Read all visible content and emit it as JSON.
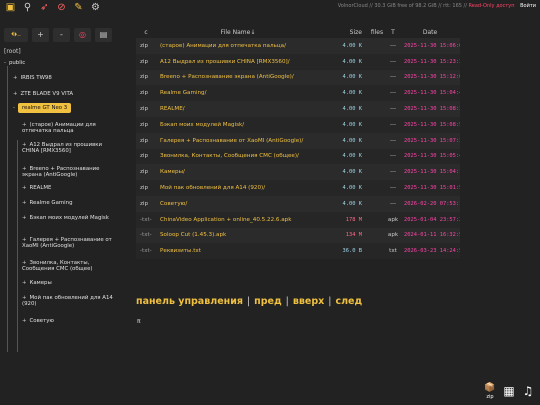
{
  "status": {
    "storage": "VolnorCloud // 30.3 GiB free of 98.2 GiB // rtt: 165 //",
    "readonly": "Read-Only доступ",
    "login": "Войти"
  },
  "toolbar_icons": [
    "package-icon",
    "search-icon",
    "rocket-icon",
    "unpost-icon",
    "broom-icon",
    "gear-icon"
  ],
  "left_tools": {
    "first": "⏴⏵..",
    "plus": "+",
    "minus": "-",
    "target": "◎",
    "doc": "▤"
  },
  "tree": {
    "root": "[root]",
    "public": "public",
    "items": [
      {
        "pfx": "+",
        "label": "IRBIS TW98"
      },
      {
        "pfx": "+",
        "label": "ZTE BLADE V9 VITA"
      },
      {
        "pfx": "-",
        "label": "realme GT Neo 3"
      }
    ],
    "children": [
      {
        "pfx": "+",
        "label": "(старое) Анимации для отпечатка пальца"
      },
      {
        "pfx": "+",
        "label": "A12 Выдрал из прошивки CHINA [RMX3560]"
      },
      {
        "pfx": "+",
        "label": "Breeno + Распознавание экрана (AntiGoogle)"
      },
      {
        "pfx": "+",
        "label": "REALME"
      },
      {
        "pfx": "+",
        "label": "Realme Gaming"
      },
      {
        "pfx": "+",
        "label": "Бэкап моих модулей Magisk"
      },
      {
        "pfx": "+",
        "label": "Галерея + Распознавание от XaoMI (AntiGoogle)"
      },
      {
        "pfx": "+",
        "label": "Звонилка, Контакты, Сообщения СМС (общее)"
      },
      {
        "pfx": "+",
        "label": "Камеры"
      },
      {
        "pfx": "+",
        "label": "Мой пак обновлений для A14 (920)"
      },
      {
        "pfx": "+",
        "label": "Советую"
      }
    ]
  },
  "table": {
    "headers": {
      "c": "c",
      "name": "File Name",
      "sort": "↓",
      "size": "Size",
      "files": "files",
      "type": "T",
      "date": "Date"
    },
    "rows": [
      {
        "c": "zip",
        "name": "(старое) Анимации для отпечатка пальца/",
        "size": "4.00 K",
        "files": "",
        "type": "---",
        "date": "2025-11-30 15:06:03"
      },
      {
        "c": "zip",
        "name": "A12 Выдрал из прошивки CHINA [RMX3560]/",
        "size": "4.00 K",
        "files": "",
        "type": "---",
        "date": "2025-11-30 15:23:34"
      },
      {
        "c": "zip",
        "name": "Breeno + Распознавание экрана (AntiGoogle)/",
        "size": "4.00 K",
        "files": "",
        "type": "---",
        "date": "2025-11-30 15:12:09"
      },
      {
        "c": "zip",
        "name": "Realme Gaming/",
        "size": "4.00 K",
        "files": "",
        "type": "---",
        "date": "2025-11-30 15:04:48"
      },
      {
        "c": "zip",
        "name": "REALME/",
        "size": "4.00 K",
        "files": "",
        "type": "---",
        "date": "2025-11-30 15:08:33"
      },
      {
        "c": "zip",
        "name": "Бэкап моих модулей Magisk/",
        "size": "4.00 K",
        "files": "",
        "type": "---",
        "date": "2025-11-30 15:08:57"
      },
      {
        "c": "zip",
        "name": "Галерея + Распознавание от XaoMI (AntiGoogle)/",
        "size": "4.00 K",
        "files": "",
        "type": "---",
        "date": "2025-11-30 15:07:36"
      },
      {
        "c": "zip",
        "name": "Звонилка, Контакты, Сообщения СМС (общее)/",
        "size": "4.00 K",
        "files": "",
        "type": "---",
        "date": "2025-11-30 15:05:43"
      },
      {
        "c": "zip",
        "name": "Камеры/",
        "size": "4.00 K",
        "files": "",
        "type": "---",
        "date": "2025-11-30 15:04:10"
      },
      {
        "c": "zip",
        "name": "Мой пак обновлений для A14 (920)/",
        "size": "4.00 K",
        "files": "",
        "type": "---",
        "date": "2025-11-30 15:01:54"
      },
      {
        "c": "zip",
        "name": "Советую/",
        "size": "4.00 K",
        "files": "",
        "type": "---",
        "date": "2026-02-20 07:53:16"
      },
      {
        "c": "-txt-",
        "name": "ChinaVideo Application + online_40.5.22.6.apk",
        "size": "178 M",
        "files": "",
        "type": "apk",
        "date": "2025-01-04 23:57:27"
      },
      {
        "c": "-txt-",
        "name": "Soloop Cut (1.45.3).apk",
        "size": "134 M",
        "files": "",
        "type": "apk",
        "date": "2024-01-11 16:32:51"
      },
      {
        "c": "-txt-",
        "name": "Реквизиты.txt",
        "size": "36.0 B",
        "files": "",
        "type": "txt",
        "date": "2026-03-23 14:24:57"
      }
    ]
  },
  "controls": {
    "panel": "панель управления",
    "up": "пред",
    "prev": "вверх",
    "next": "след"
  },
  "pi": "π",
  "bottom": {
    "zip_label": "zip",
    "zip_glyph": "📦",
    "grid_glyph": "▦",
    "music_glyph": "♫"
  }
}
